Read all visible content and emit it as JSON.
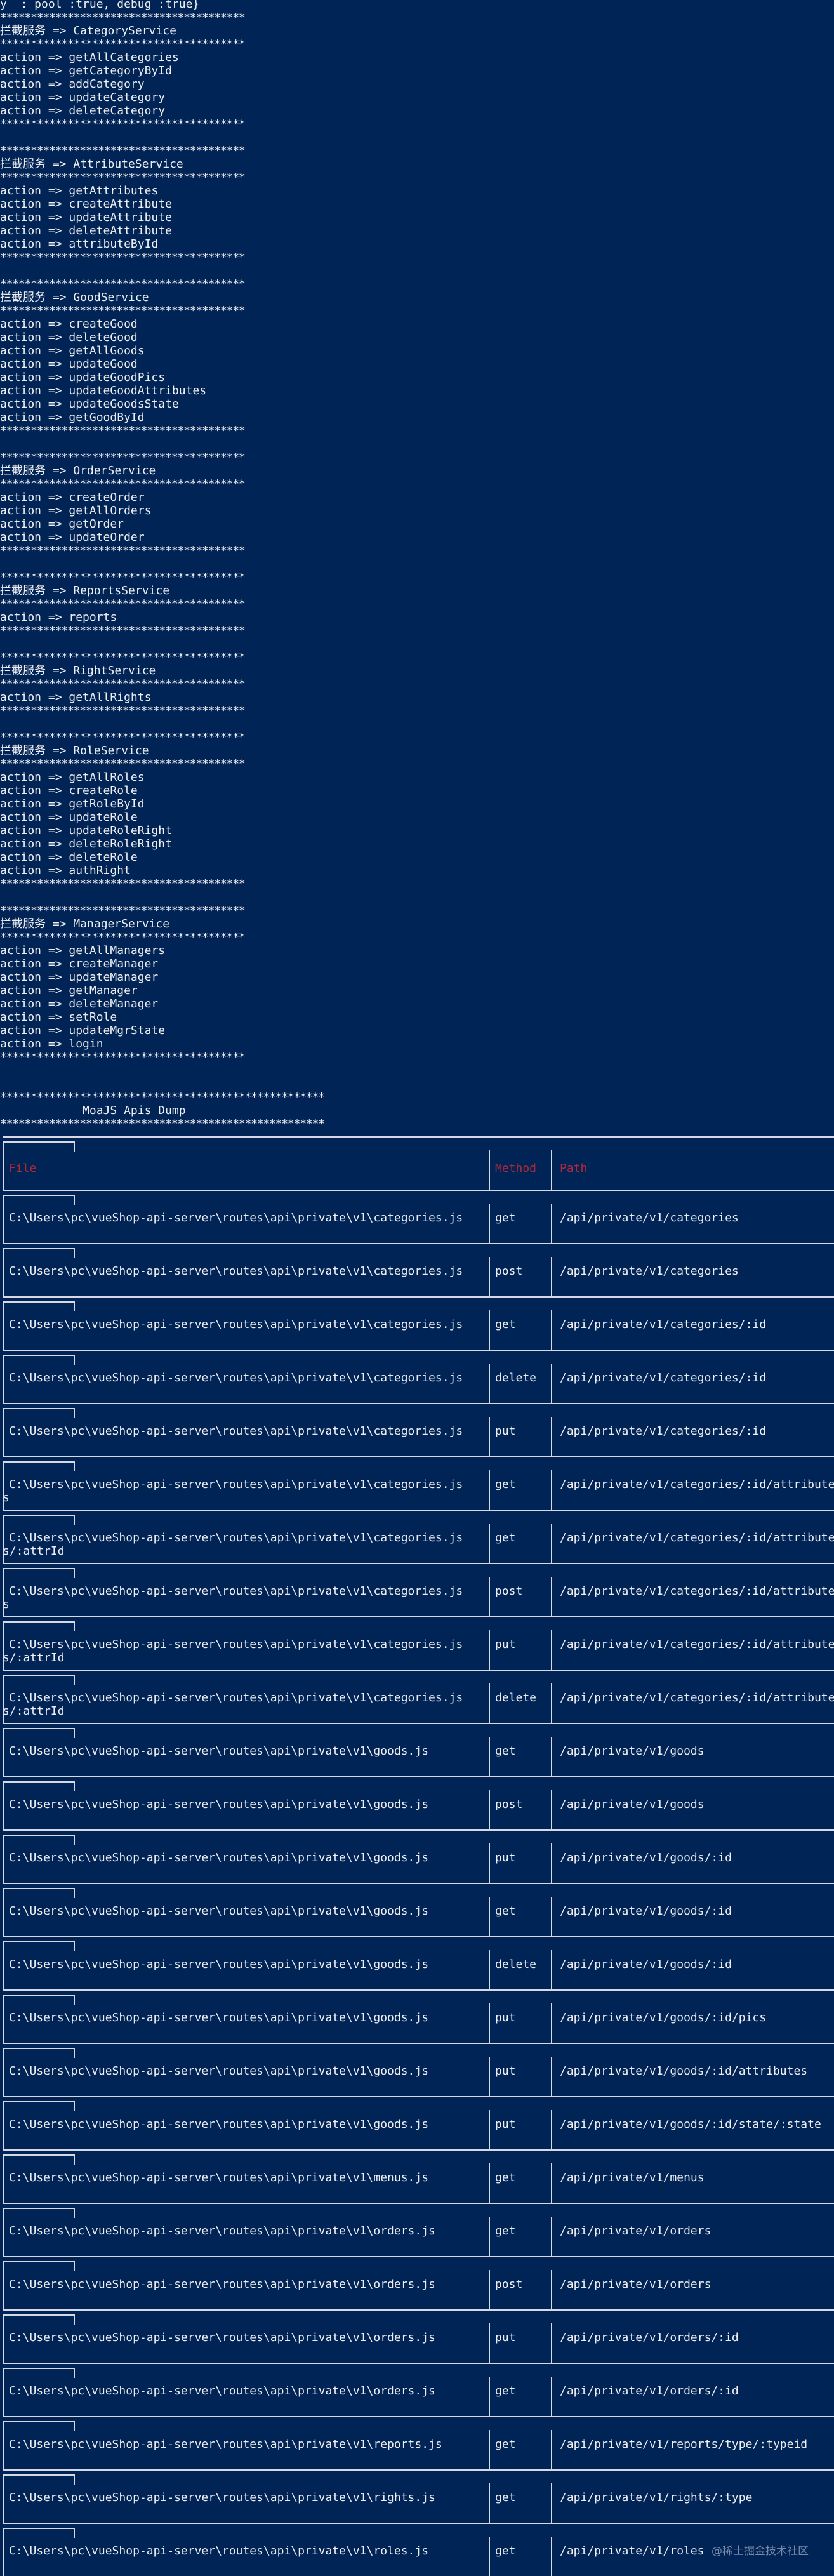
{
  "top_line": "y  : pool :true, debug :true}",
  "sections": [
    {
      "title": "拦截服务 => CategoryService",
      "actions": [
        "getAllCategories",
        "getCategoryById",
        "addCategory",
        "updateCategory",
        "deleteCategory"
      ]
    },
    {
      "title": "拦截服务 => AttributeService",
      "actions": [
        "getAttributes",
        "createAttribute",
        "updateAttribute",
        "deleteAttribute",
        "attributeById"
      ]
    },
    {
      "title": "拦截服务 => GoodService",
      "actions": [
        "createGood",
        "deleteGood",
        "getAllGoods",
        "updateGood",
        "updateGoodPics",
        "updateGoodAttributes",
        "updateGoodsState",
        "getGoodById"
      ]
    },
    {
      "title": "拦截服务 => OrderService",
      "actions": [
        "createOrder",
        "getAllOrders",
        "getOrder",
        "updateOrder"
      ]
    },
    {
      "title": "拦截服务 => ReportsService",
      "actions": [
        "reports"
      ]
    },
    {
      "title": "拦截服务 => RightService",
      "actions": [
        "getAllRights"
      ]
    },
    {
      "title": "拦截服务 => RoleService",
      "actions": [
        "getAllRoles",
        "createRole",
        "getRoleById",
        "updateRole",
        "updateRoleRight",
        "deleteRoleRight",
        "deleteRole",
        "authRight"
      ]
    },
    {
      "title": "拦截服务 => ManagerService",
      "actions": [
        "getAllManagers",
        "createManager",
        "updateManager",
        "getManager",
        "deleteManager",
        "setRole",
        "updateMgrState",
        "login"
      ]
    }
  ],
  "action_prefix": "action => ",
  "stars_short": "****************************************",
  "stars_long": "*****************************************************",
  "dump_title": "MoaJS Apis Dump",
  "table": {
    "headers": {
      "file": "File",
      "method": "Method",
      "path": "Path"
    },
    "rows": [
      {
        "file": "C:\\Users\\pc\\vueShop-api-server\\routes\\api\\private\\v1\\categories.js",
        "method": "get",
        "path": "/api/private/v1/categories",
        "wrap": ""
      },
      {
        "file": "C:\\Users\\pc\\vueShop-api-server\\routes\\api\\private\\v1\\categories.js",
        "method": "post",
        "path": "/api/private/v1/categories",
        "wrap": ""
      },
      {
        "file": "C:\\Users\\pc\\vueShop-api-server\\routes\\api\\private\\v1\\categories.js",
        "method": "get",
        "path": "/api/private/v1/categories/:id",
        "wrap": ""
      },
      {
        "file": "C:\\Users\\pc\\vueShop-api-server\\routes\\api\\private\\v1\\categories.js",
        "method": "delete",
        "path": "/api/private/v1/categories/:id",
        "wrap": ""
      },
      {
        "file": "C:\\Users\\pc\\vueShop-api-server\\routes\\api\\private\\v1\\categories.js",
        "method": "put",
        "path": "/api/private/v1/categories/:id",
        "wrap": ""
      },
      {
        "file": "C:\\Users\\pc\\vueShop-api-server\\routes\\api\\private\\v1\\categories.js",
        "method": "get",
        "path": "/api/private/v1/categories/:id/attribute",
        "wrap": "s"
      },
      {
        "file": "C:\\Users\\pc\\vueShop-api-server\\routes\\api\\private\\v1\\categories.js",
        "method": "get",
        "path": "/api/private/v1/categories/:id/attribute",
        "wrap": "s/:attrId"
      },
      {
        "file": "C:\\Users\\pc\\vueShop-api-server\\routes\\api\\private\\v1\\categories.js",
        "method": "post",
        "path": "/api/private/v1/categories/:id/attribute",
        "wrap": "s"
      },
      {
        "file": "C:\\Users\\pc\\vueShop-api-server\\routes\\api\\private\\v1\\categories.js",
        "method": "put",
        "path": "/api/private/v1/categories/:id/attribute",
        "wrap": "s/:attrId"
      },
      {
        "file": "C:\\Users\\pc\\vueShop-api-server\\routes\\api\\private\\v1\\categories.js",
        "method": "delete",
        "path": "/api/private/v1/categories/:id/attribute",
        "wrap": "s/:attrId"
      },
      {
        "file": "C:\\Users\\pc\\vueShop-api-server\\routes\\api\\private\\v1\\goods.js",
        "method": "get",
        "path": "/api/private/v1/goods",
        "wrap": ""
      },
      {
        "file": "C:\\Users\\pc\\vueShop-api-server\\routes\\api\\private\\v1\\goods.js",
        "method": "post",
        "path": "/api/private/v1/goods",
        "wrap": ""
      },
      {
        "file": "C:\\Users\\pc\\vueShop-api-server\\routes\\api\\private\\v1\\goods.js",
        "method": "put",
        "path": "/api/private/v1/goods/:id",
        "wrap": ""
      },
      {
        "file": "C:\\Users\\pc\\vueShop-api-server\\routes\\api\\private\\v1\\goods.js",
        "method": "get",
        "path": "/api/private/v1/goods/:id",
        "wrap": ""
      },
      {
        "file": "C:\\Users\\pc\\vueShop-api-server\\routes\\api\\private\\v1\\goods.js",
        "method": "delete",
        "path": "/api/private/v1/goods/:id",
        "wrap": ""
      },
      {
        "file": "C:\\Users\\pc\\vueShop-api-server\\routes\\api\\private\\v1\\goods.js",
        "method": "put",
        "path": "/api/private/v1/goods/:id/pics",
        "wrap": ""
      },
      {
        "file": "C:\\Users\\pc\\vueShop-api-server\\routes\\api\\private\\v1\\goods.js",
        "method": "put",
        "path": "/api/private/v1/goods/:id/attributes",
        "wrap": ""
      },
      {
        "file": "C:\\Users\\pc\\vueShop-api-server\\routes\\api\\private\\v1\\goods.js",
        "method": "put",
        "path": "/api/private/v1/goods/:id/state/:state",
        "wrap": ""
      },
      {
        "file": "C:\\Users\\pc\\vueShop-api-server\\routes\\api\\private\\v1\\menus.js",
        "method": "get",
        "path": "/api/private/v1/menus",
        "wrap": ""
      },
      {
        "file": "C:\\Users\\pc\\vueShop-api-server\\routes\\api\\private\\v1\\orders.js",
        "method": "get",
        "path": "/api/private/v1/orders",
        "wrap": ""
      },
      {
        "file": "C:\\Users\\pc\\vueShop-api-server\\routes\\api\\private\\v1\\orders.js",
        "method": "post",
        "path": "/api/private/v1/orders",
        "wrap": ""
      },
      {
        "file": "C:\\Users\\pc\\vueShop-api-server\\routes\\api\\private\\v1\\orders.js",
        "method": "put",
        "path": "/api/private/v1/orders/:id",
        "wrap": ""
      },
      {
        "file": "C:\\Users\\pc\\vueShop-api-server\\routes\\api\\private\\v1\\orders.js",
        "method": "get",
        "path": "/api/private/v1/orders/:id",
        "wrap": ""
      },
      {
        "file": "C:\\Users\\pc\\vueShop-api-server\\routes\\api\\private\\v1\\reports.js",
        "method": "get",
        "path": "/api/private/v1/reports/type/:typeid",
        "wrap": ""
      },
      {
        "file": "C:\\Users\\pc\\vueShop-api-server\\routes\\api\\private\\v1\\rights.js",
        "method": "get",
        "path": "/api/private/v1/rights/:type",
        "wrap": ""
      },
      {
        "file": "C:\\Users\\pc\\vueShop-api-server\\routes\\api\\private\\v1\\roles.js",
        "method": "get",
        "path": "/api/private/v1/roles",
        "wrap": ""
      }
    ]
  },
  "watermark": "@稀土掘金技术社区",
  "colors": {
    "background": "#012456",
    "text": "#eeedf0",
    "header": "#b0283a"
  }
}
